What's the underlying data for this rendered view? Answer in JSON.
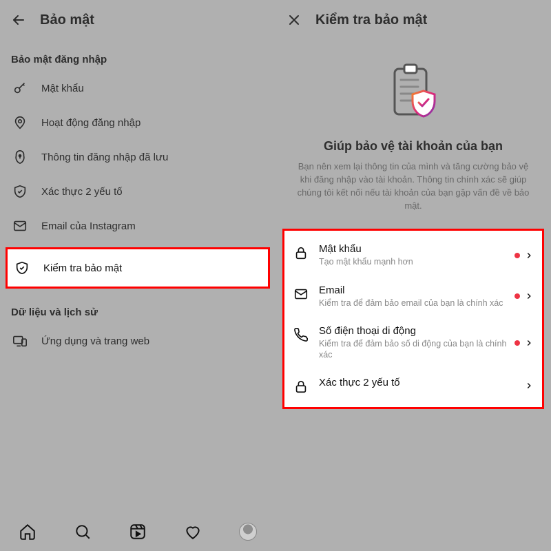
{
  "left": {
    "title": "Bảo mật",
    "section_login": "Bảo mật đăng nhập",
    "items_login": [
      {
        "label": "Mật khẩu",
        "icon": "key-icon"
      },
      {
        "label": "Hoạt động đăng nhập",
        "icon": "location-pin-icon"
      },
      {
        "label": "Thông tin đăng nhập đã lưu",
        "icon": "keyhole-icon"
      },
      {
        "label": "Xác thực 2 yếu tố",
        "icon": "shield-check-icon"
      },
      {
        "label": "Email của Instagram",
        "icon": "mail-icon"
      }
    ],
    "highlight": {
      "label": "Kiểm tra bảo mật",
      "icon": "shield-check-icon"
    },
    "section_history": "Dữ liệu và lịch sử",
    "items_history": [
      {
        "label": "Ứng dụng và trang web",
        "icon": "devices-icon"
      }
    ]
  },
  "right": {
    "title": "Kiểm tra bảo mật",
    "hero_heading": "Giúp bảo vệ tài khoản của bạn",
    "hero_body": "Bạn nên xem lại thông tin của mình và tăng cường bảo vệ khi đăng nhập vào tài khoản. Thông tin chính xác sẽ giúp chúng tôi kết nối nếu tài khoản của bạn gặp vấn đề về bảo mật.",
    "items": [
      {
        "title": "Mật khẩu",
        "subtitle": "Tạo mật khẩu mạnh hơn",
        "icon": "lock-icon",
        "dot": true
      },
      {
        "title": "Email",
        "subtitle": "Kiểm tra để đảm bảo email của bạn là chính xác",
        "icon": "mail-icon",
        "dot": true
      },
      {
        "title": "Số điện thoại di động",
        "subtitle": "Kiểm tra để đảm bảo số di động của bạn là chính xác",
        "icon": "phone-icon",
        "dot": true
      },
      {
        "title": "Xác thực 2 yếu tố",
        "subtitle": "",
        "icon": "lock-icon",
        "dot": false
      }
    ]
  },
  "nav_icons": [
    "home-icon",
    "search-icon",
    "reels-icon",
    "heart-icon",
    "avatar-icon"
  ]
}
